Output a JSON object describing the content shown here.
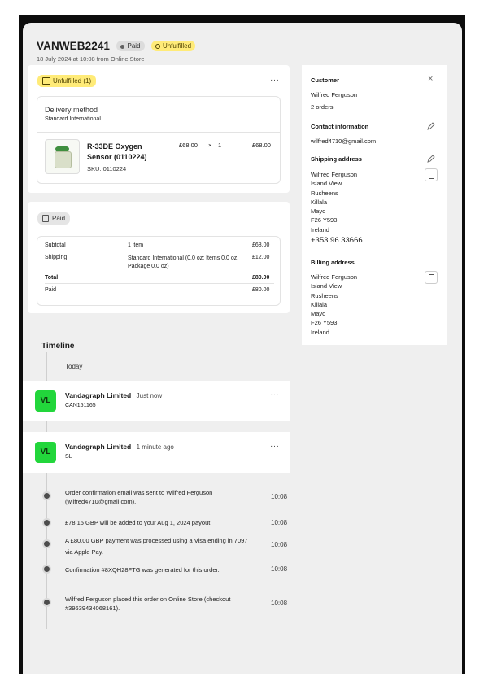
{
  "order": {
    "id": "VANWEB2241",
    "paid_badge": "Paid",
    "fulfillment_badge": "Unfulfilled",
    "subtitle": "18 July 2024 at 10:08 from Online Store"
  },
  "fulfillment_card": {
    "status_label": "Unfulfilled (1)",
    "more": "···",
    "delivery_method_label": "Delivery method",
    "delivery_method_value": "Standard International",
    "item": {
      "name_line1": "R-33DE Oxygen",
      "name_line2": "Sensor (0110224)",
      "sku": "SKU: 0110224",
      "price": "£68.00",
      "times": "×",
      "qty": "1",
      "total": "£68.00"
    }
  },
  "payment_card": {
    "status_label": "Paid",
    "rows": [
      {
        "label": "Subtotal",
        "desc": "1 item",
        "amount": "£68.00"
      },
      {
        "label": "Shipping",
        "desc": "Standard International (0.0 oz: Items 0.0 oz, Package 0.0 oz)",
        "amount": "£12.00"
      },
      {
        "label": "Total",
        "desc": "",
        "amount": "£80.00"
      },
      {
        "label": "Paid",
        "desc": "",
        "amount": "£80.00"
      }
    ]
  },
  "timeline": {
    "title": "Timeline",
    "today": "Today",
    "comments": [
      {
        "initials": "VL",
        "author": "Vandagraph Limited",
        "time": "Just now",
        "text": "CAN151165",
        "more": "···"
      },
      {
        "initials": "VL",
        "author": "Vandagraph Limited",
        "time": "1 minute ago",
        "text": "SL",
        "more": "···"
      }
    ],
    "events": [
      {
        "text": "Order confirmation email was sent to Wilfred Ferguson (wilfred4710@gmail.com).",
        "time": "10:08"
      },
      {
        "text": "£78.15 GBP will be added to your Aug 1, 2024 payout.",
        "time": "10:08"
      },
      {
        "text": "A £80.00 GBP payment was processed using a Visa ending in 7097 via Apple Pay.",
        "time": "10:08"
      },
      {
        "text": "Confirmation #8XQH28FTG was generated for this order.",
        "time": "10:08"
      },
      {
        "text": "Wilfred Ferguson placed this order on Online Store (checkout #39639434068161).",
        "time": "10:08"
      }
    ]
  },
  "sidebar": {
    "customer_heading": "Customer",
    "close": "×",
    "customer_name": "Wilfred Ferguson",
    "customer_orders": "2 orders",
    "contact_heading": "Contact information",
    "contact_email": "wilfred4710@gmail.com",
    "shipping_heading": "Shipping address",
    "shipping_lines": [
      "Wilfred Ferguson",
      "Island View",
      "Rusheens",
      "Killala",
      "Mayo",
      "F26 Y593",
      "Ireland"
    ],
    "shipping_phone": "+353 96 33666",
    "billing_heading": "Billing address",
    "billing_lines": [
      "Wilfred Ferguson",
      "Island View",
      "Rusheens",
      "Killala",
      "Mayo",
      "F26 Y593",
      "Ireland"
    ]
  }
}
